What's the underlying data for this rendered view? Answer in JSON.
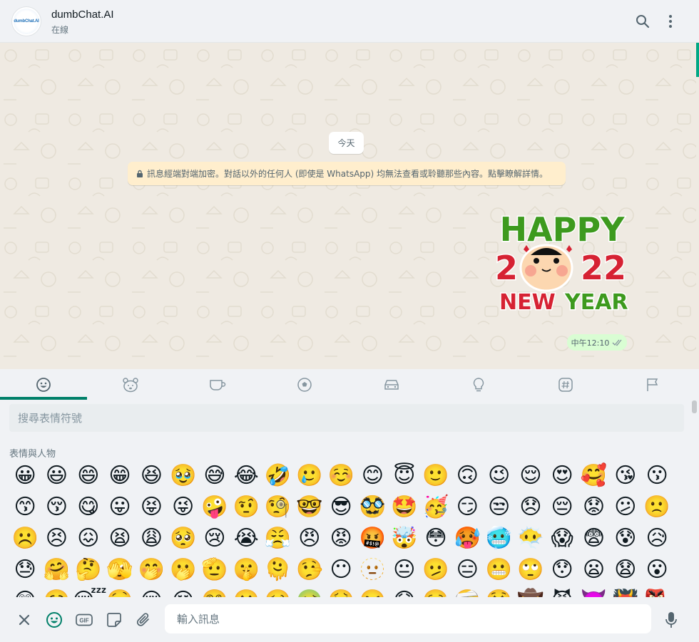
{
  "header": {
    "contact_name": "dumbChat.AI",
    "status": "在線",
    "avatar_text": "dumbChat.AI"
  },
  "chat": {
    "date_label": "今天",
    "encryption_notice": "訊息經端對端加密。對話以外的任何人 (即使是 WhatsApp) 均無法查看或聆聽那些內容。點擊瞭解詳情。",
    "sticker": {
      "line1": "HAPPY",
      "line2_left": "2",
      "line2_right": "22",
      "line3_left": "NEW",
      "line3_right": "YEAR"
    },
    "message_time": "中午12:10"
  },
  "emoji_panel": {
    "tabs": [
      {
        "icon": "smiley-icon",
        "active": true
      },
      {
        "icon": "bear-icon",
        "active": false
      },
      {
        "icon": "cup-icon",
        "active": false
      },
      {
        "icon": "soccer-ball-icon",
        "active": false
      },
      {
        "icon": "car-icon",
        "active": false
      },
      {
        "icon": "lightbulb-icon",
        "active": false
      },
      {
        "icon": "hash-icon",
        "active": false
      },
      {
        "icon": "flag-icon",
        "active": false
      }
    ],
    "search_placeholder": "搜尋表情符號",
    "section_title": "表情與人物",
    "emojis": [
      "😀",
      "😃",
      "😄",
      "😁",
      "😆",
      "🥹",
      "😅",
      "😂",
      "🤣",
      "🥲",
      "☺️",
      "😊",
      "😇",
      "🙂",
      "🙃",
      "😉",
      "😌",
      "😍",
      "🥰",
      "😘",
      "😗",
      "😙",
      "😚",
      "😋",
      "😛",
      "😝",
      "😜",
      "🤪",
      "🤨",
      "🧐",
      "🤓",
      "😎",
      "🥸",
      "🤩",
      "🥳",
      "😏",
      "😒",
      "😞",
      "😔",
      "😟",
      "😕",
      "🙁",
      "☹️",
      "😣",
      "😖",
      "😫",
      "😩",
      "🥺",
      "😢",
      "😭",
      "😤",
      "😠",
      "😡",
      "🤬",
      "🤯",
      "😳",
      "🥵",
      "🥶",
      "😶‍🌫️",
      "😱",
      "😨",
      "😰",
      "😥",
      "😓",
      "🤗",
      "🤔",
      "🫣",
      "🤭",
      "🫢",
      "🫡",
      "🤫",
      "🫠",
      "🤥",
      "😶",
      "🫥",
      "😐",
      "🫤",
      "😑",
      "😬",
      "🙄",
      "😯",
      "😦",
      "😧",
      "😮",
      "😲",
      "🥱",
      "😴",
      "🤤",
      "😪",
      "😵",
      "😵‍💫",
      "🤐",
      "🥴",
      "🤢",
      "🤮",
      "🤧",
      "😷",
      "🤒",
      "🤕",
      "🤑",
      "🤠",
      "😈",
      "👿",
      "👹",
      "👺"
    ]
  },
  "footer": {
    "input_placeholder": "輸入訊息",
    "gif_label": "GIF"
  },
  "colors": {
    "accent": "#00a884",
    "tab_underline": "#008069",
    "header_bg": "#f0f2f5",
    "chat_bg": "#efeae2",
    "notice_bg": "#ffeecd",
    "outgoing_bg": "#d9fdd3",
    "icon": "#54656f"
  }
}
